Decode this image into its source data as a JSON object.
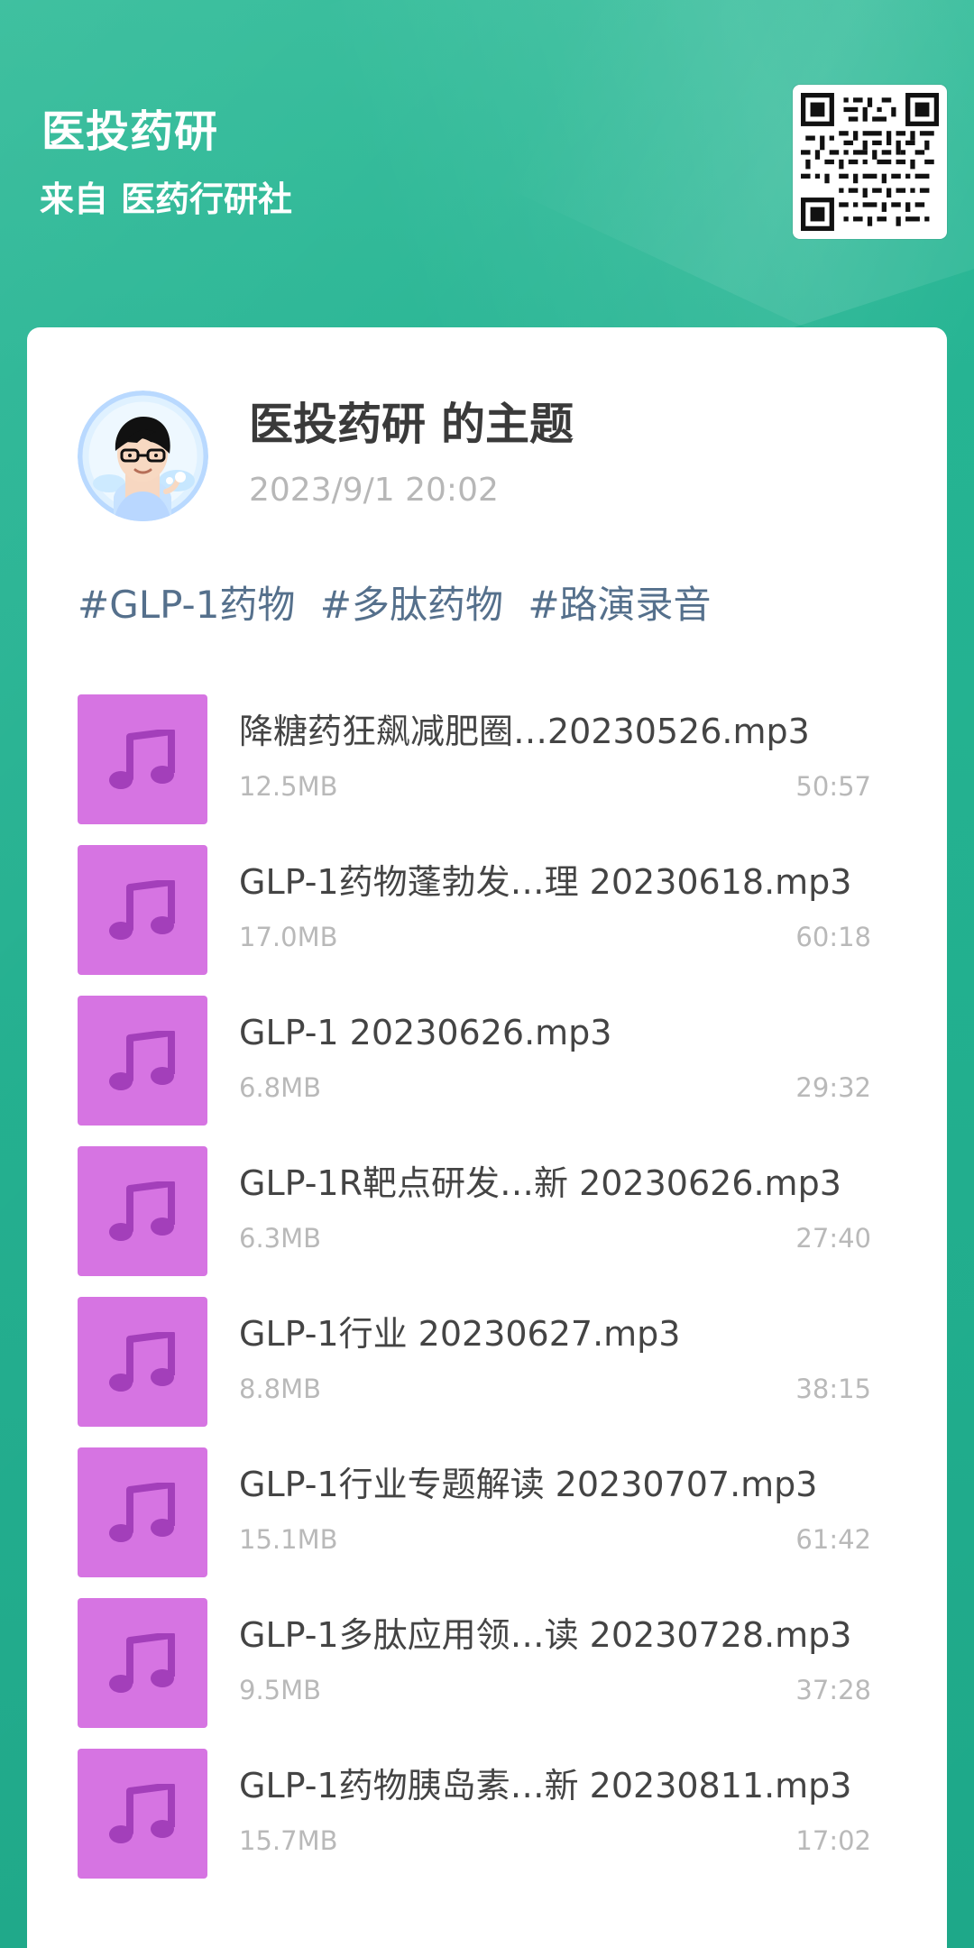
{
  "header": {
    "title": "医投药研",
    "subtitle_prefix": "来自",
    "subtitle_source": "医药行研社"
  },
  "card": {
    "title": "医投药研 的主题",
    "date": "2023/9/1 20:02",
    "tags": [
      "#GLP-1药物",
      "#多肽药物",
      "#路演录音"
    ]
  },
  "icons": {
    "audio": "music-note-icon",
    "qr": "qr-code-icon",
    "avatar": "avatar-icon"
  },
  "colors": {
    "accent": "#1fb091",
    "tile": "#d674e2",
    "icon": "#9f37b7",
    "tag": "#55708c"
  },
  "files": [
    {
      "name": "降糖药狂飙减肥圈…20230526.mp3",
      "size": "12.5MB",
      "duration": "50:57"
    },
    {
      "name": "GLP-1药物蓬勃发…理 20230618.mp3",
      "size": "17.0MB",
      "duration": "60:18"
    },
    {
      "name": "GLP-1 20230626.mp3",
      "size": "6.8MB",
      "duration": "29:32"
    },
    {
      "name": "GLP-1R靶点研发…新 20230626.mp3",
      "size": "6.3MB",
      "duration": "27:40"
    },
    {
      "name": "GLP-1行业 20230627.mp3",
      "size": "8.8MB",
      "duration": "38:15"
    },
    {
      "name": "GLP-1行业专题解读 20230707.mp3",
      "size": "15.1MB",
      "duration": "61:42"
    },
    {
      "name": "GLP-1多肽应用领…读 20230728.mp3",
      "size": "9.5MB",
      "duration": "37:28"
    },
    {
      "name": "GLP-1药物胰岛素…新 20230811.mp3",
      "size": "15.7MB",
      "duration": "17:02"
    }
  ]
}
